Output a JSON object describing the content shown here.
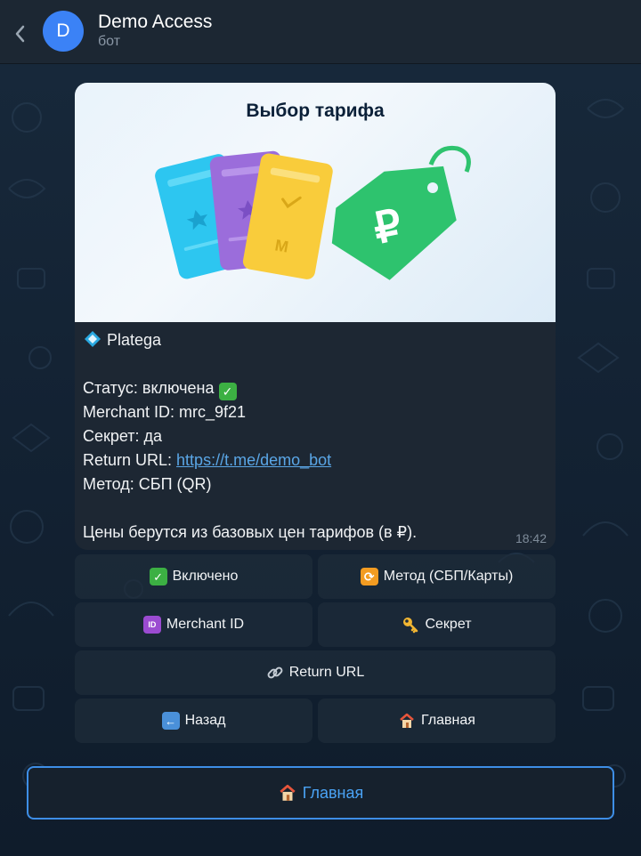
{
  "header": {
    "back_icon": "chevron-left-icon",
    "avatar_letter": "D",
    "avatar_color": "#3b82f6",
    "title": "Demo Access",
    "subtitle": "бот"
  },
  "banner": {
    "title": "Выбор тарифа",
    "card_letter": "М",
    "tag_symbol": "₽"
  },
  "message": {
    "header_emoji": "diamond-icon",
    "header_name": "Platega",
    "status_label": "Статус: включена",
    "merchant_line": "Merchant ID: mrc_9f21",
    "secret_line": "Секрет: да",
    "return_label": "Return URL: ",
    "return_link": "https://t.me/demo_bot",
    "method_line": "Метод: СБП (QR)",
    "footer_line": "Цены берутся из базовых цен тарифов (в ₽).",
    "time": "18:42"
  },
  "keyboard": {
    "enabled": "Включено",
    "method": "Метод (СБП/Карты)",
    "merchant_id": "Merchant ID",
    "secret": "Секрет",
    "return_url": "Return URL",
    "back": "Назад",
    "home": "Главная"
  },
  "main_button": {
    "label": "Главная"
  },
  "colors": {
    "header_bg": "#1c2733",
    "bubble_bg": "#1d2733",
    "link": "#5aa6e6",
    "accent": "#3e8ee6"
  }
}
